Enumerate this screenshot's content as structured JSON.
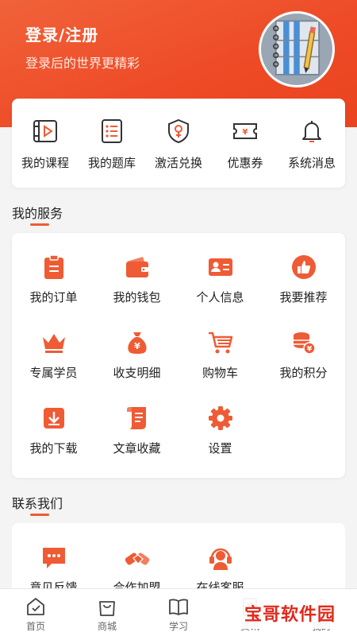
{
  "header": {
    "title": "登录/注册",
    "subtitle": "登录后的世界更精彩",
    "accent_color": "#ef5b34"
  },
  "quick_links": [
    {
      "label": "我的课程",
      "icon": "course-video-icon"
    },
    {
      "label": "我的题库",
      "icon": "question-bank-icon"
    },
    {
      "label": "激活兑换",
      "icon": "activate-shield-icon"
    },
    {
      "label": "优惠券",
      "icon": "coupon-icon"
    },
    {
      "label": "系统消息",
      "icon": "bell-icon"
    }
  ],
  "services": {
    "title": "我的服务",
    "items": [
      {
        "label": "我的订单",
        "icon": "order-clipboard-icon"
      },
      {
        "label": "我的钱包",
        "icon": "wallet-icon"
      },
      {
        "label": "个人信息",
        "icon": "id-card-icon"
      },
      {
        "label": "我要推荐",
        "icon": "thumbs-up-icon"
      },
      {
        "label": "专属学员",
        "icon": "crown-icon"
      },
      {
        "label": "收支明细",
        "icon": "money-bag-icon"
      },
      {
        "label": "购物车",
        "icon": "cart-icon"
      },
      {
        "label": "我的积分",
        "icon": "coins-icon"
      },
      {
        "label": "我的下载",
        "icon": "download-icon"
      },
      {
        "label": "文章收藏",
        "icon": "scroll-icon"
      },
      {
        "label": "设置",
        "icon": "gear-icon"
      }
    ]
  },
  "contact": {
    "title": "联系我们",
    "items": [
      {
        "label": "意见反馈",
        "icon": "feedback-chat-icon"
      },
      {
        "label": "合作加盟",
        "icon": "handshake-icon"
      },
      {
        "label": "在线客服",
        "icon": "headset-icon"
      }
    ]
  },
  "tabbar": [
    {
      "label": "首页",
      "icon": "home-icon"
    },
    {
      "label": "商城",
      "icon": "shop-bag-icon"
    },
    {
      "label": "学习",
      "icon": "book-icon"
    },
    {
      "label": "资讯",
      "icon": "news-icon"
    },
    {
      "label": "我的",
      "icon": "profile-icon"
    }
  ],
  "watermark": {
    "text": "宝哥软件园"
  }
}
